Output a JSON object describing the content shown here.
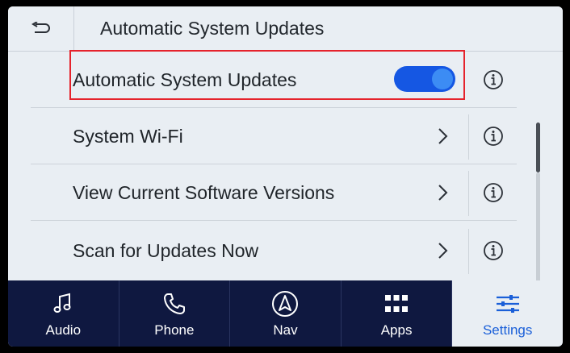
{
  "header": {
    "back_icon": "back-arrow-icon",
    "title": "Automatic System Updates"
  },
  "list": {
    "rows": [
      {
        "label": "Automatic System Updates",
        "control": "toggle",
        "toggle_on": true
      },
      {
        "label": "System Wi-Fi",
        "control": "chevron"
      },
      {
        "label": "View Current Software Versions",
        "control": "chevron"
      },
      {
        "label": "Scan for Updates Now",
        "control": "chevron"
      }
    ]
  },
  "nav": {
    "items": [
      {
        "label": "Audio",
        "icon": "music-note-icon"
      },
      {
        "label": "Phone",
        "icon": "phone-icon"
      },
      {
        "label": "Nav",
        "icon": "navigation-arrow-icon"
      },
      {
        "label": "Apps",
        "icon": "apps-grid-icon"
      },
      {
        "label": "Settings",
        "icon": "settings-sliders-icon",
        "active": true
      }
    ]
  },
  "colors": {
    "toggle_on": "#1557e3",
    "highlight_border": "#e5232c",
    "nav_background": "#0f1840",
    "nav_active_label": "#1a5fd8"
  }
}
